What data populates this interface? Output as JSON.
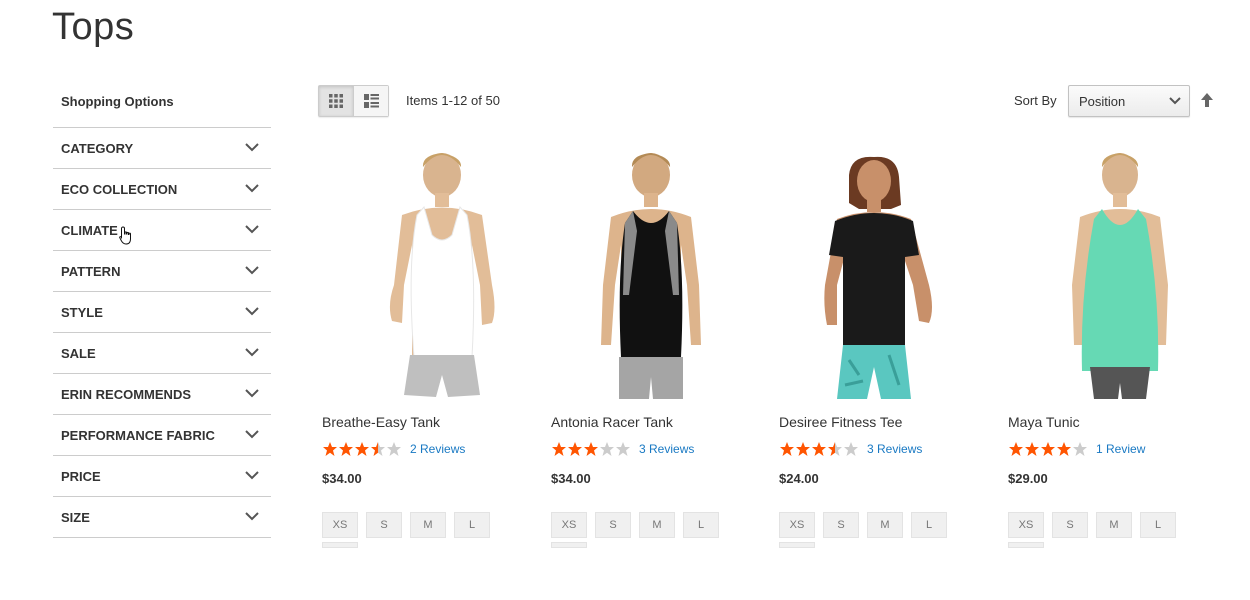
{
  "page": {
    "title": "Tops"
  },
  "sidebar": {
    "title": "Shopping Options",
    "filters": [
      {
        "label": "CATEGORY"
      },
      {
        "label": "ECO COLLECTION"
      },
      {
        "label": "CLIMATE"
      },
      {
        "label": "PATTERN"
      },
      {
        "label": "STYLE"
      },
      {
        "label": "SALE"
      },
      {
        "label": "ERIN RECOMMENDS"
      },
      {
        "label": "PERFORMANCE FABRIC"
      },
      {
        "label": "PRICE"
      },
      {
        "label": "SIZE"
      }
    ]
  },
  "toolbar": {
    "view_modes": [
      {
        "icon": "grid-icon",
        "active": true
      },
      {
        "icon": "list-icon",
        "active": false
      }
    ],
    "amount": "Items 1-12 of 50",
    "sort_label": "Sort By",
    "sort_value": "Position",
    "sort_direction_icon": "arrow-up-icon"
  },
  "colors": {
    "star_filled": "#ff5501",
    "star_empty": "#cccccc",
    "link": "#1979c3"
  },
  "products": [
    {
      "name": "Breathe-Easy Tank",
      "rating_stars": 3.5,
      "reviews": "2  Reviews",
      "price": "$34.00",
      "sizes": [
        "XS",
        "S",
        "M",
        "L"
      ]
    },
    {
      "name": "Antonia Racer Tank",
      "rating_stars": 3,
      "reviews": "3  Reviews",
      "price": "$34.00",
      "sizes": [
        "XS",
        "S",
        "M",
        "L"
      ]
    },
    {
      "name": "Desiree Fitness Tee",
      "rating_stars": 3.5,
      "reviews": "3  Reviews",
      "price": "$24.00",
      "sizes": [
        "XS",
        "S",
        "M",
        "L"
      ]
    },
    {
      "name": "Maya Tunic",
      "rating_stars": 4,
      "reviews": "1  Review",
      "price": "$29.00",
      "sizes": [
        "XS",
        "S",
        "M",
        "L"
      ]
    }
  ]
}
